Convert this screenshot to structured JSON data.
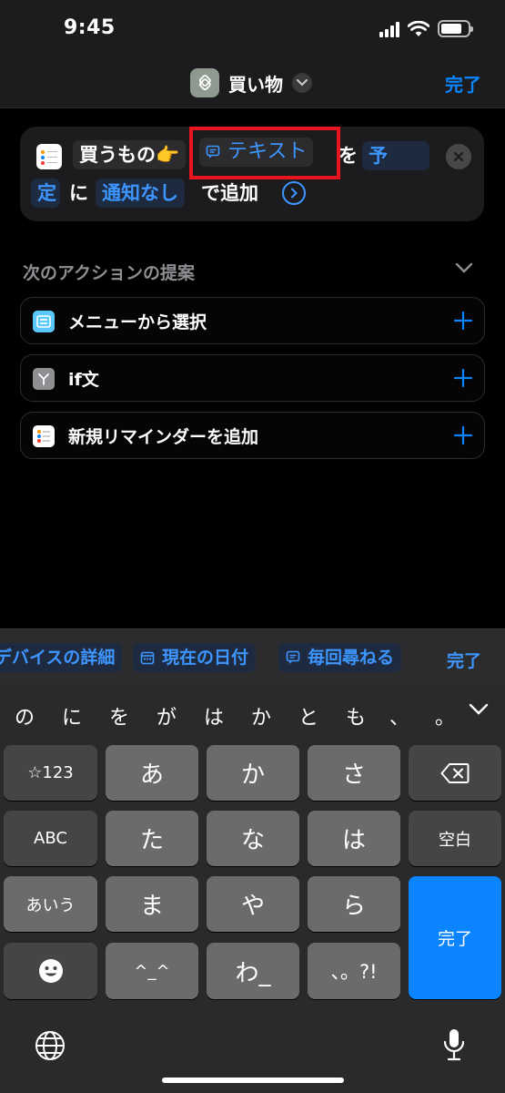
{
  "status": {
    "time": "9:45"
  },
  "nav": {
    "title": "買い物",
    "done": "完了"
  },
  "action": {
    "list_name": "買うもの👉",
    "text_token": "テキスト",
    "wo": "を",
    "date_part1": "予",
    "date_part2": "定",
    "ni": "に",
    "alert_token": "通知なし",
    "suffix": "で追加"
  },
  "suggestions": {
    "title": "次のアクションの提案",
    "items": [
      {
        "label": "メニューから選択",
        "icon": "menu-icon",
        "color": "#5ac8fa"
      },
      {
        "label": "if文",
        "icon": "branch-icon",
        "color": "#8e8e93"
      },
      {
        "label": "新規リマインダーを追加",
        "icon": "reminders-icon",
        "color": "#ffffff"
      }
    ]
  },
  "accessory": {
    "chips": [
      "デバイスの詳細",
      "現在の日付",
      "毎回尋ねる"
    ],
    "done": "完了"
  },
  "keyboard": {
    "candidates": [
      "の",
      "に",
      "を",
      "が",
      "は",
      "か",
      "と",
      "も",
      "、",
      "。"
    ],
    "keys": {
      "num": "☆123",
      "a": "あ",
      "ka": "か",
      "sa": "さ",
      "abc": "ABC",
      "ta": "た",
      "na": "な",
      "ha": "は",
      "space": "空白",
      "aiu": "あいう",
      "ma": "ま",
      "ya": "や",
      "ra": "ら",
      "done": "完了",
      "kao": "^_^",
      "wa": "わ_",
      "punct": "、。?!"
    }
  },
  "colors": {
    "accent": "#0a84ff",
    "highlight": "#e8141e"
  }
}
